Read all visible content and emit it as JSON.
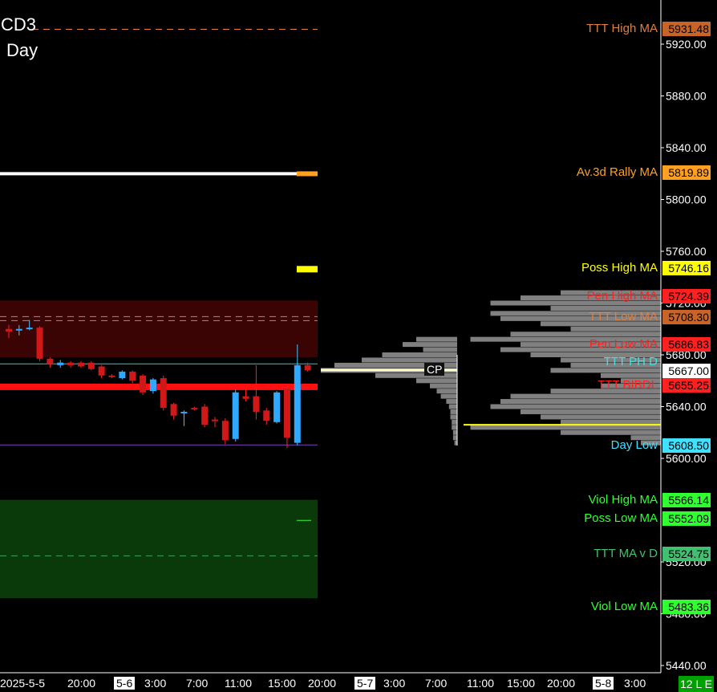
{
  "header": {
    "symbol": "CD3",
    "timeframe": "Day"
  },
  "status_badge": "12 L E",
  "cp_label": "CP",
  "colors": {
    "background": "#000000",
    "up_candle": "#2fa8ff",
    "down_candle": "#d01818",
    "resistance_zone": "#3a0404",
    "support_zone": "#0a3a0a"
  },
  "chart_data": {
    "type": "candlestick",
    "y_axis": {
      "ticks": [
        "5920.00",
        "5880.00",
        "5840.00",
        "5800.00",
        "5760.00",
        "5720.00",
        "5680.00",
        "5640.00",
        "5600.00",
        "5520.00",
        "5480.00",
        "5440.00"
      ],
      "range": [
        5433,
        5943
      ]
    },
    "x_axis": {
      "ticks": [
        {
          "label": "2025-5-5",
          "boxed": false
        },
        {
          "label": "20:00",
          "boxed": false
        },
        {
          "label": "5-6",
          "boxed": true
        },
        {
          "label": "3:00",
          "boxed": false
        },
        {
          "label": "7:00",
          "boxed": false
        },
        {
          "label": "11:00",
          "boxed": false
        },
        {
          "label": "15:00",
          "boxed": false
        },
        {
          "label": "20:00",
          "boxed": false
        },
        {
          "label": "5-7",
          "boxed": true
        },
        {
          "label": "3:00",
          "boxed": false
        },
        {
          "label": "7:00",
          "boxed": false
        },
        {
          "label": "11:00",
          "boxed": false
        },
        {
          "label": "15:00",
          "boxed": false
        },
        {
          "label": "20:00",
          "boxed": false
        },
        {
          "label": "5-8",
          "boxed": true
        },
        {
          "label": "3:00",
          "boxed": false
        }
      ]
    },
    "candles": [
      {
        "o": 5700,
        "h": 5703,
        "l": 5693,
        "c": 5698
      },
      {
        "o": 5699,
        "h": 5703,
        "l": 5695,
        "c": 5700
      },
      {
        "o": 5700,
        "h": 5707,
        "l": 5699,
        "c": 5701
      },
      {
        "o": 5701,
        "h": 5702,
        "l": 5675,
        "c": 5677
      },
      {
        "o": 5677,
        "h": 5678,
        "l": 5670,
        "c": 5673
      },
      {
        "o": 5672,
        "h": 5676,
        "l": 5670,
        "c": 5674
      },
      {
        "o": 5674,
        "h": 5675,
        "l": 5670,
        "c": 5672
      },
      {
        "o": 5674,
        "h": 5675,
        "l": 5670,
        "c": 5671
      },
      {
        "o": 5674,
        "h": 5675,
        "l": 5668,
        "c": 5669
      },
      {
        "o": 5671,
        "h": 5672,
        "l": 5662,
        "c": 5664
      },
      {
        "o": 5664,
        "h": 5665,
        "l": 5662,
        "c": 5663
      },
      {
        "o": 5662,
        "h": 5668,
        "l": 5661,
        "c": 5667
      },
      {
        "o": 5667,
        "h": 5668,
        "l": 5658,
        "c": 5660
      },
      {
        "o": 5664,
        "h": 5665,
        "l": 5649,
        "c": 5651
      },
      {
        "o": 5652,
        "h": 5662,
        "l": 5650,
        "c": 5661
      },
      {
        "o": 5662,
        "h": 5664,
        "l": 5637,
        "c": 5639
      },
      {
        "o": 5642,
        "h": 5643,
        "l": 5630,
        "c": 5633
      },
      {
        "o": 5635,
        "h": 5637,
        "l": 5625,
        "c": 5636
      },
      {
        "o": 5639,
        "h": 5640,
        "l": 5637,
        "c": 5638
      },
      {
        "o": 5640,
        "h": 5642,
        "l": 5624,
        "c": 5626
      },
      {
        "o": 5630,
        "h": 5632,
        "l": 5624,
        "c": 5629
      },
      {
        "o": 5629,
        "h": 5631,
        "l": 5611,
        "c": 5614
      },
      {
        "o": 5615,
        "h": 5653,
        "l": 5613,
        "c": 5651
      },
      {
        "o": 5648,
        "h": 5654,
        "l": 5644,
        "c": 5646
      },
      {
        "o": 5648,
        "h": 5672,
        "l": 5630,
        "c": 5636
      },
      {
        "o": 5637,
        "h": 5639,
        "l": 5626,
        "c": 5629
      },
      {
        "o": 5628,
        "h": 5652,
        "l": 5627,
        "c": 5651
      },
      {
        "o": 5654,
        "h": 5655,
        "l": 5608,
        "c": 5616
      },
      {
        "o": 5612,
        "h": 5688,
        "l": 5610,
        "c": 5672
      },
      {
        "o": 5672,
        "h": 5674,
        "l": 5667,
        "c": 5668
      }
    ],
    "levels": [
      {
        "name": "TTT High MA",
        "value": "5931.48",
        "color": "#e08040",
        "text_color": "#e08040",
        "badge_bg": "#c86428",
        "badge_text": "#000000"
      },
      {
        "name": "Av.3d Rally MA",
        "value": "5819.89",
        "color": "#ffa020",
        "text_color": "#ffa020",
        "badge_bg": "#ffa020",
        "badge_text": "#000000"
      },
      {
        "name": "Poss High MA",
        "value": "5746.16",
        "color": "#ffff00",
        "text_color": "#ffff00",
        "badge_bg": "#ffff00",
        "badge_text": "#000000"
      },
      {
        "name": "Pen High MA",
        "value": "5724.39",
        "color": "#ff2020",
        "text_color": "#ff2020",
        "badge_bg": "#ff2020",
        "badge_text": "#000000"
      },
      {
        "name": "TTT Low MA",
        "value": "5708.30",
        "color": "#e08040",
        "text_color": "#e08040",
        "badge_bg": "#c86428",
        "badge_text": "#000000"
      },
      {
        "name": "Pen Low MA",
        "value": "5686.83",
        "color": "#ff2020",
        "text_color": "#ff2020",
        "badge_bg": "#ff2020",
        "badge_text": "#000000"
      },
      {
        "name": "TTT PH D",
        "value": "",
        "color": "#40e0e0",
        "text_color": "#40e0e0",
        "badge_bg": "#40e0e0",
        "badge_text": "#000000"
      },
      {
        "name": "",
        "value": "5667.00",
        "color": "#ffffff",
        "text_color": "#ffffff",
        "badge_bg": "#ffffff",
        "badge_text": "#000000"
      },
      {
        "name": "TTT BIBDL",
        "value": "5655.25",
        "color": "#ff2020",
        "text_color": "#ff2020",
        "badge_bg": "#ff2020",
        "badge_text": "#000000"
      },
      {
        "name": "Day Low",
        "value": "5608.50",
        "color": "#40e0ff",
        "text_color": "#40e0ff",
        "badge_bg": "#40e0ff",
        "badge_text": "#000000"
      },
      {
        "name": "Viol High MA",
        "value": "5566.14",
        "color": "#30ff30",
        "text_color": "#30ff30",
        "badge_bg": "#30ff30",
        "badge_text": "#000000"
      },
      {
        "name": "Poss Low MA",
        "value": "5552.09",
        "color": "#30ff30",
        "text_color": "#30ff30",
        "badge_bg": "#30ff30",
        "badge_text": "#000000"
      },
      {
        "name": "TTT MA v D",
        "value": "5524.75",
        "color": "#40c070",
        "text_color": "#40c070",
        "badge_bg": "#40c070",
        "badge_text": "#000000"
      },
      {
        "name": "Viol Low MA",
        "value": "5483.36",
        "color": "#30ff30",
        "text_color": "#30ff30",
        "badge_bg": "#30ff30",
        "badge_text": "#000000"
      }
    ],
    "zones": [
      {
        "name": "resistance",
        "from": 5678,
        "to": 5722
      },
      {
        "name": "support",
        "from": 5492,
        "to": 5568
      }
    ],
    "volume_profile": [
      {
        "p": 5728,
        "v": 0.5
      },
      {
        "p": 5724,
        "v": 0.7
      },
      {
        "p": 5720,
        "v": 0.85
      },
      {
        "p": 5716,
        "v": 0.55
      },
      {
        "p": 5712,
        "v": 0.85
      },
      {
        "p": 5708,
        "v": 0.8
      },
      {
        "p": 5704,
        "v": 0.6
      },
      {
        "p": 5700,
        "v": 0.45
      },
      {
        "p": 5696,
        "v": 0.75
      },
      {
        "p": 5692,
        "v": 0.95
      },
      {
        "p": 5688,
        "v": 0.7
      },
      {
        "p": 5684,
        "v": 0.8
      },
      {
        "p": 5680,
        "v": 0.65
      },
      {
        "p": 5676,
        "v": 0.5
      },
      {
        "p": 5672,
        "v": 0.45
      },
      {
        "p": 5668,
        "v": 0.55
      },
      {
        "p": 5664,
        "v": 0.3
      },
      {
        "p": 5660,
        "v": 0.2
      },
      {
        "p": 5656,
        "v": 0.3
      },
      {
        "p": 5652,
        "v": 0.55
      },
      {
        "p": 5648,
        "v": 0.75
      },
      {
        "p": 5644,
        "v": 0.8
      },
      {
        "p": 5640,
        "v": 0.85
      },
      {
        "p": 5636,
        "v": 0.7
      },
      {
        "p": 5632,
        "v": 0.6
      },
      {
        "p": 5628,
        "v": 0.5
      },
      {
        "p": 5624,
        "v": 0.95
      },
      {
        "p": 5620,
        "v": 0.5
      },
      {
        "p": 5616,
        "v": 0.15
      },
      {
        "p": 5612,
        "v": 0.1
      }
    ],
    "left_profile": [
      {
        "p": 5692,
        "v": 0.3
      },
      {
        "p": 5688,
        "v": 0.4
      },
      {
        "p": 5684,
        "v": 0.25
      },
      {
        "p": 5680,
        "v": 0.55
      },
      {
        "p": 5676,
        "v": 0.7
      },
      {
        "p": 5672,
        "v": 0.9
      },
      {
        "p": 5668,
        "v": 1.0
      },
      {
        "p": 5664,
        "v": 0.6
      },
      {
        "p": 5660,
        "v": 0.3
      },
      {
        "p": 5656,
        "v": 0.2
      },
      {
        "p": 5652,
        "v": 0.15
      },
      {
        "p": 5648,
        "v": 0.12
      },
      {
        "p": 5644,
        "v": 0.08
      },
      {
        "p": 5640,
        "v": 0.06
      },
      {
        "p": 5636,
        "v": 0.05
      },
      {
        "p": 5632,
        "v": 0.05
      },
      {
        "p": 5628,
        "v": 0.04
      },
      {
        "p": 5624,
        "v": 0.04
      },
      {
        "p": 5620,
        "v": 0.03
      },
      {
        "p": 5616,
        "v": 0.03
      },
      {
        "p": 5612,
        "v": 0.02
      }
    ]
  }
}
